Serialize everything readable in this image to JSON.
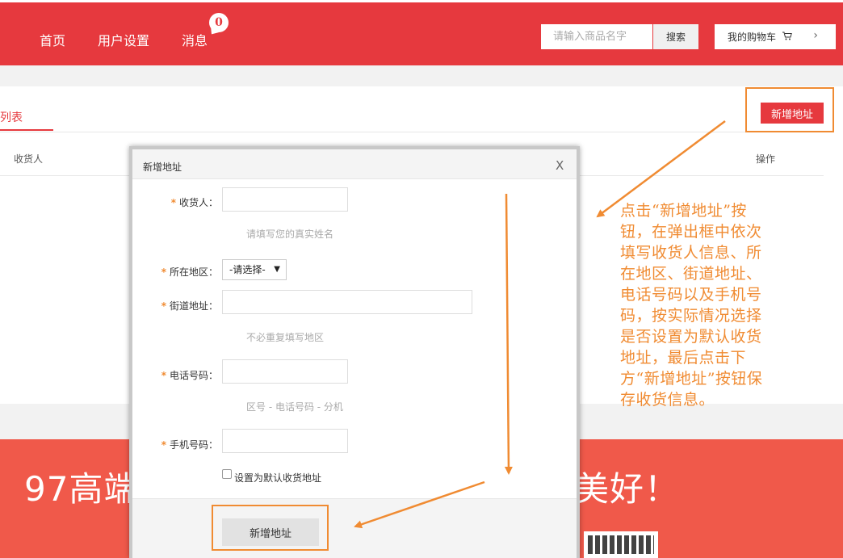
{
  "header": {
    "nav": [
      "首页",
      "用户设置",
      "消息"
    ],
    "badge_count": "0",
    "search_placeholder": "请输入商品名字",
    "search_button": "搜索",
    "cart_label": "我的购物车",
    "cart_icon": "cart-icon",
    "chevron": "›"
  },
  "panel": {
    "tab_label": "地址列表",
    "col_receiver": "收货人",
    "col_ops": "操作",
    "add_button": "新增地址"
  },
  "modal": {
    "title": "新增地址",
    "close": "X",
    "fields": {
      "receiver": {
        "label": "收货人：",
        "hint": "请填写您的真实姓名"
      },
      "region": {
        "label": "所在地区：",
        "select_value": "-请选择-"
      },
      "street": {
        "label": "街道地址：",
        "hint": "不必重复填写地区"
      },
      "phone": {
        "label": "电话号码：",
        "hint": "区号 - 电话号码 - 分机"
      },
      "mobile": {
        "label": "手机号码："
      }
    },
    "required_mark": "*",
    "default_checkbox_label": "设置为默认收货地址",
    "submit_button": "新增地址"
  },
  "footer": {
    "slogan_left": "97高端",
    "slogan_right": "美好！"
  },
  "annotation": {
    "text": "点击“新增地址”按钮，在弹出框中依次填写收货人信息、所在地区、街道地址、电话号码以及手机号码，按实际情况选择是否设置为默认收货地址，最后点击下方“新增地址”按钮保存收货信息。"
  },
  "colors": {
    "brand_red": "#e6393e",
    "footer_red": "#f0594a",
    "annotation_orange": "#f08b32"
  }
}
